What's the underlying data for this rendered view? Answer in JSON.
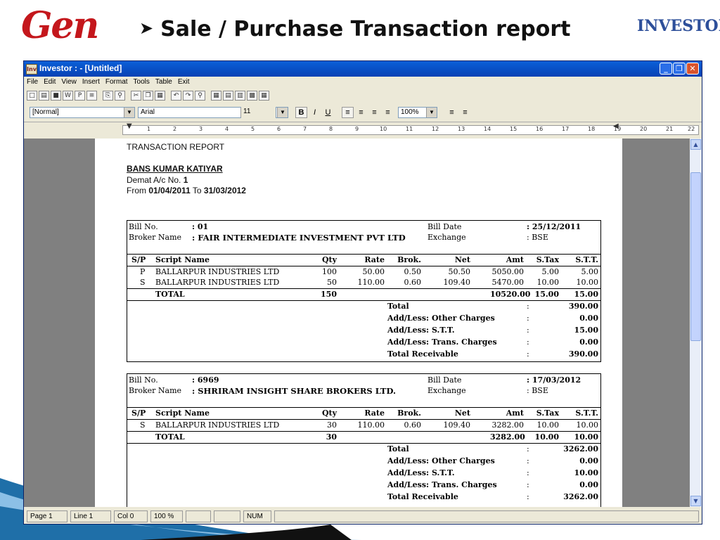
{
  "slide": {
    "logo_left": "Gen",
    "title": "Sale / Purchase Transaction report",
    "logo_right": "INVESTOR"
  },
  "window": {
    "title": "Investor : - [Untitled]",
    "menu": [
      "File",
      "Edit",
      "View",
      "Insert",
      "Format",
      "Tools",
      "Table",
      "Exit"
    ],
    "style_combo": "[Normal]",
    "font_combo": "Arial",
    "size_combo": "11",
    "zoom_combo": "100%",
    "ruler_ticks": [
      "1",
      "2",
      "3",
      "4",
      "5",
      "6",
      "7",
      "8",
      "9",
      "10",
      "11",
      "12",
      "13",
      "14",
      "15",
      "16",
      "17",
      "18",
      "19",
      "20",
      "21",
      "22"
    ]
  },
  "report": {
    "heading": "TRANSACTION REPORT",
    "client_name": "BANS KUMAR KATIYAR",
    "demat_label": "Demat A/c No.",
    "demat_no": "1",
    "from_label": "From",
    "from_date": "01/04/2011",
    "to_label": "To",
    "to_date": "31/03/2012",
    "labels": {
      "bill_no": "Bill No.",
      "broker_name": "Broker Name",
      "bill_date": "Bill Date",
      "exchange": "Exchange",
      "col_sp": "S/P",
      "col_script": "Script Name",
      "col_qty": "Qty",
      "col_rate": "Rate",
      "col_brok": "Brok.",
      "col_net": "Net",
      "col_amt": "Amt",
      "col_stax": "S.Tax",
      "col_stt": "S.T.T.",
      "total_row": "TOTAL",
      "sum_total": "Total",
      "sum_other": "Add/Less: Other Charges",
      "sum_stt": "Add/Less: S.T.T.",
      "sum_trans": "Add/Less: Trans. Charges",
      "sum_receivable": "Total Receivable",
      "colon": ":"
    },
    "bills": [
      {
        "bill_no": "01",
        "broker": "FAIR INTERMEDIATE INVESTMENT PVT LTD",
        "bill_date": "25/12/2011",
        "exchange": "BSE",
        "rows": [
          {
            "sp": "P",
            "script": "BALLARPUR INDUSTRIES LTD",
            "qty": "100",
            "rate": "50.00",
            "brok": "0.50",
            "net": "50.50",
            "amt": "5050.00",
            "stax": "5.00",
            "stt": "5.00"
          },
          {
            "sp": "S",
            "script": "BALLARPUR INDUSTRIES LTD",
            "qty": "50",
            "rate": "110.00",
            "brok": "0.60",
            "net": "109.40",
            "amt": "5470.00",
            "stax": "10.00",
            "stt": "10.00"
          }
        ],
        "total": {
          "qty": "150",
          "amt": "10520.00",
          "stax": "15.00",
          "stt": "15.00"
        },
        "summary": {
          "total": "390.00",
          "other": "0.00",
          "stt": "15.00",
          "trans": "0.00",
          "receivable": "390.00"
        }
      },
      {
        "bill_no": "6969",
        "broker": "SHRIRAM INSIGHT SHARE BROKERS LTD.",
        "bill_date": "17/03/2012",
        "exchange": "BSE",
        "rows": [
          {
            "sp": "S",
            "script": "BALLARPUR INDUSTRIES LTD",
            "qty": "30",
            "rate": "110.00",
            "brok": "0.60",
            "net": "109.40",
            "amt": "3282.00",
            "stax": "10.00",
            "stt": "10.00"
          }
        ],
        "total": {
          "qty": "30",
          "amt": "3282.00",
          "stax": "10.00",
          "stt": "10.00"
        },
        "summary": {
          "total": "3262.00",
          "other": "0.00",
          "stt": "10.00",
          "trans": "0.00",
          "receivable": "3262.00"
        }
      }
    ]
  },
  "status": {
    "page": "Page 1",
    "line": "Line 1",
    "col": "Col 0",
    "zoom": "100 %",
    "num": "NUM"
  },
  "colors": {
    "titlebar": "#0a5fd8",
    "logo_red": "#c4171c",
    "logo_blue": "#2d4f9a",
    "deco_blue": "#1f6fa8"
  }
}
